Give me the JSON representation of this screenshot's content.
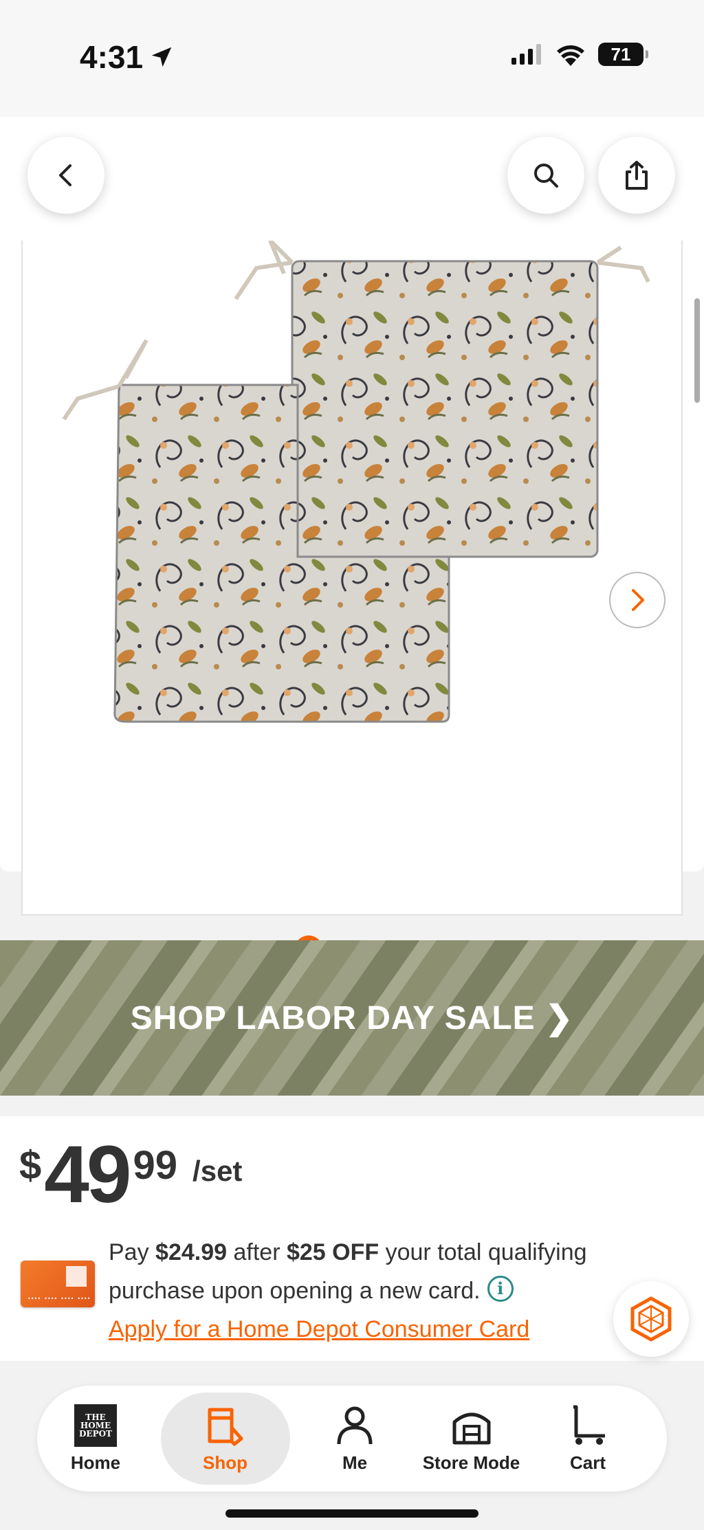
{
  "status_bar": {
    "time": "4:31",
    "battery": "71"
  },
  "nav": {
    "back_icon": "chevron-left-icon",
    "search_icon": "search-icon",
    "share_icon": "share-icon"
  },
  "gallery": {
    "image_alt": "Paisley outdoor chair cushions set of 2",
    "current_index": 1,
    "total_images": 3
  },
  "banner": {
    "text": "SHOP LABOR DAY SALE ❯"
  },
  "price": {
    "dollar_sign": "$",
    "whole": "49",
    "cents": "99",
    "unit": "/set"
  },
  "promo": {
    "pay_prefix": "Pay ",
    "pay_amount": "$24.99",
    "after_text": " after ",
    "discount": "$25 OFF",
    "rest_text": " your total qualifying purchase upon opening a new card.",
    "info_icon": "i",
    "apply_link": "Apply for a Home Depot Consumer Card"
  },
  "tabs": [
    {
      "label": "Home",
      "icon": "home-depot-logo-icon"
    },
    {
      "label": "Shop",
      "icon": "shop-icon"
    },
    {
      "label": "Me",
      "icon": "person-icon"
    },
    {
      "label": "Store Mode",
      "icon": "store-icon"
    },
    {
      "label": "Cart",
      "icon": "cart-icon"
    }
  ],
  "colors": {
    "brand_orange": "#f96302",
    "banner_olive": "#8c9071",
    "info_teal": "#2a8a88"
  }
}
